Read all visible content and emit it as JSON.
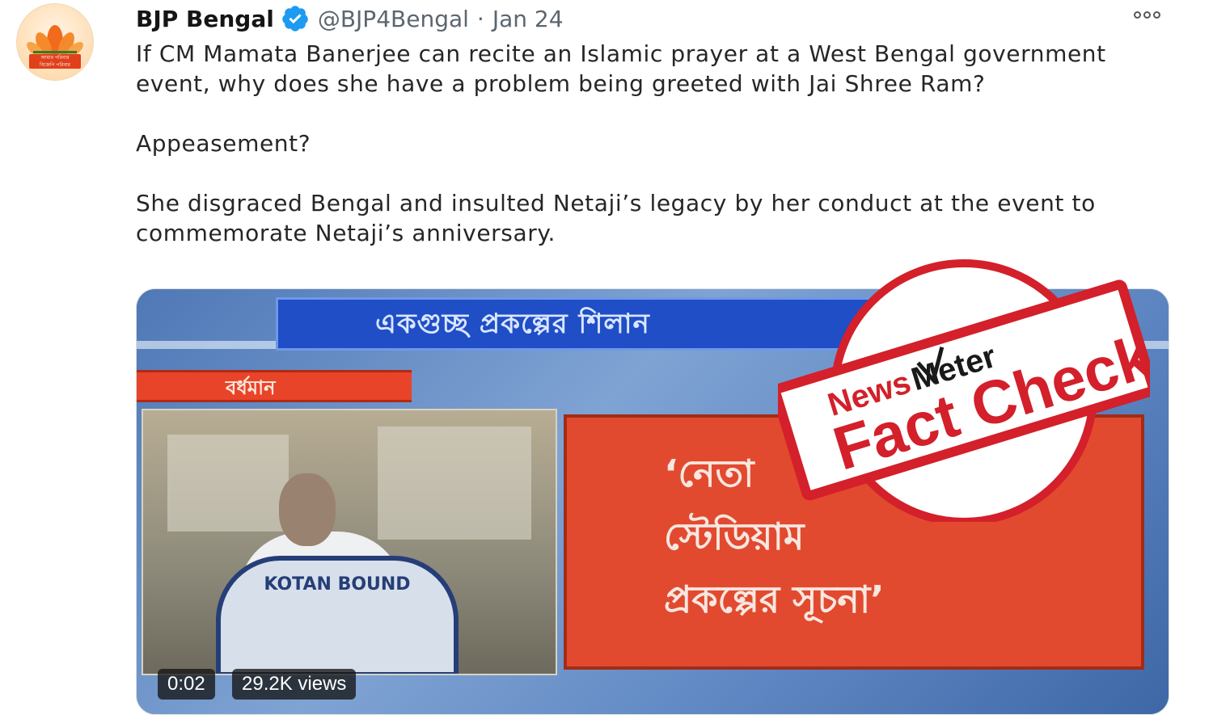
{
  "account": {
    "name": "BJP Bengal",
    "handle": "@BJP4Bengal",
    "separator": "·",
    "date": "Jan 24",
    "avatar_banner_line1": "আমার পরিবার",
    "avatar_banner_line2": "বিজেপি পরিবার"
  },
  "tweet": {
    "paragraph1": "If CM Mamata Banerjee can recite an Islamic prayer at a West Bengal government event, why does she have a problem being greeted with Jai Shree Ram?",
    "paragraph2": "Appeasement?",
    "paragraph3": "She disgraced Bengal and insulted Netaji’s legacy by her conduct at the event to commemorate Netaji’s anniversary."
  },
  "video": {
    "ticker_text": "একগুচ্ছ প্রকল্পের শিলান",
    "place_tag": "বর্ধমান",
    "quote_line1": "‘নেতা",
    "quote_line2": "স্টেডিয়াম",
    "quote_line3": "প্রকল্পের সূচনা’",
    "podium_text": "KOTAN BOUND",
    "time": "0:02",
    "views": "29.2K views"
  },
  "watermark": {
    "brand_news": "News",
    "brand_meter": "Meter",
    "label": "Fact Check"
  },
  "colors": {
    "verified_blue": "#1d9bf0",
    "stamp_red": "#d3202a",
    "handle_gray": "#5b6670"
  },
  "icons": {
    "verified": "verified-badge-icon",
    "more": "more-options-icon"
  }
}
